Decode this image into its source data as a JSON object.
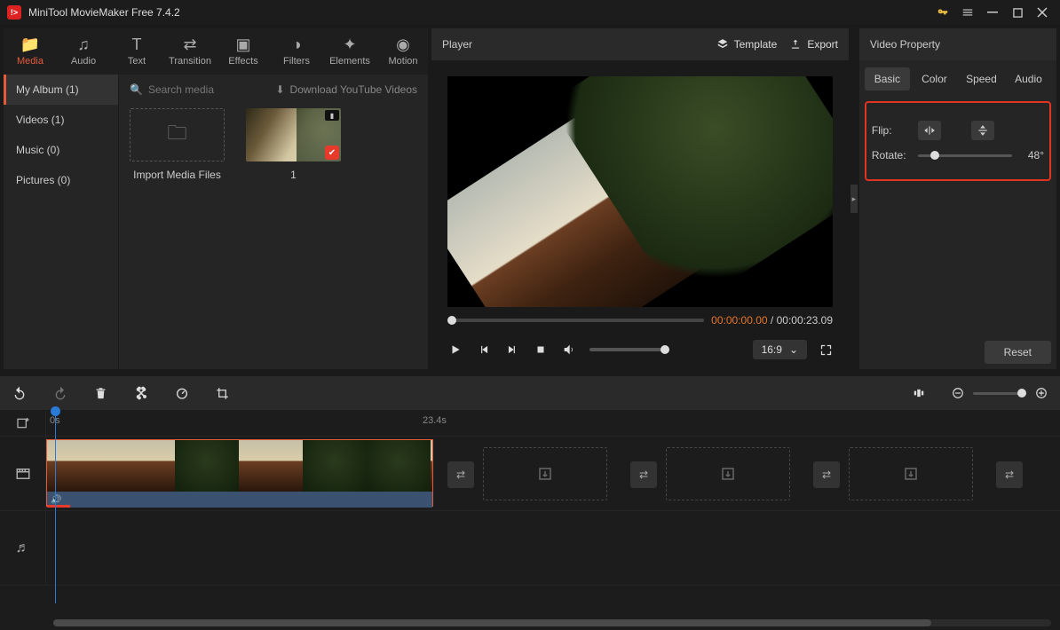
{
  "titlebar": {
    "app": "MiniTool MovieMaker Free 7.4.2"
  },
  "tabs": {
    "media": "Media",
    "audio": "Audio",
    "text": "Text",
    "transition": "Transition",
    "effects": "Effects",
    "filters": "Filters",
    "elements": "Elements",
    "motion": "Motion"
  },
  "sidebar": {
    "my_album": "My Album (1)",
    "videos": "Videos (1)",
    "music": "Music (0)",
    "pictures": "Pictures (0)"
  },
  "media": {
    "search_placeholder": "Search media",
    "download": "Download YouTube Videos",
    "import": "Import Media Files",
    "clip_label": "1"
  },
  "player": {
    "title": "Player",
    "template": "Template",
    "export": "Export",
    "time_current": "00:00:00.00",
    "time_sep": " / ",
    "time_total": "00:00:23.09",
    "ratio": "16:9"
  },
  "property": {
    "title": "Video Property",
    "tabs": {
      "basic": "Basic",
      "color": "Color",
      "speed": "Speed",
      "audio": "Audio"
    },
    "flip_label": "Flip:",
    "rotate_label": "Rotate:",
    "rotate_value": "48°",
    "rotate_percent": 13,
    "reset": "Reset"
  },
  "ruler": {
    "t0": "0s",
    "t1": "23.4s"
  },
  "slots_x": [
    492,
    698,
    904
  ],
  "trans_x": [
    452,
    658,
    864,
    1070
  ]
}
